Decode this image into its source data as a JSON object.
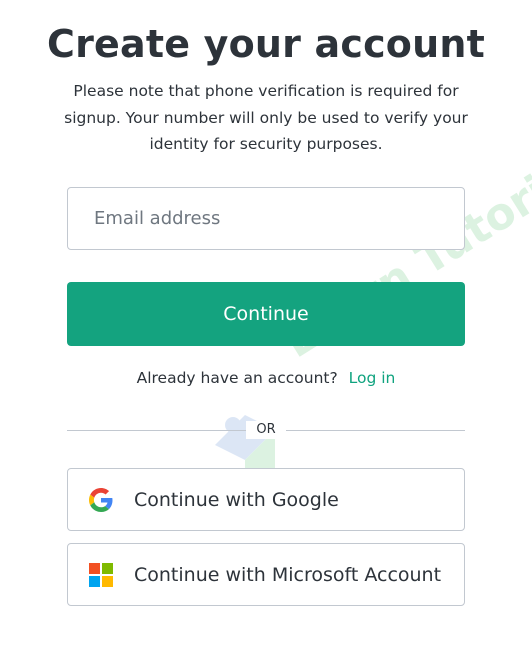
{
  "page": {
    "title": "Create your account",
    "subtitle": "Please note that phone verification is required for signup. Your number will only be used to verify your identity for security purposes."
  },
  "form": {
    "email_placeholder": "Email address",
    "email_value": "",
    "continue_label": "Continue"
  },
  "login": {
    "prompt": "Already have an account?",
    "link_label": "Log in"
  },
  "divider": {
    "label": "OR"
  },
  "social": {
    "google_label": "Continue with Google",
    "microsoft_label": "Continue with Microsoft Account"
  },
  "colors": {
    "primary": "#10a37f",
    "text": "#2d333a",
    "border": "#c2c8d0"
  },
  "icons": {
    "google": "google-logo-icon",
    "microsoft": "microsoft-logo-icon"
  }
}
